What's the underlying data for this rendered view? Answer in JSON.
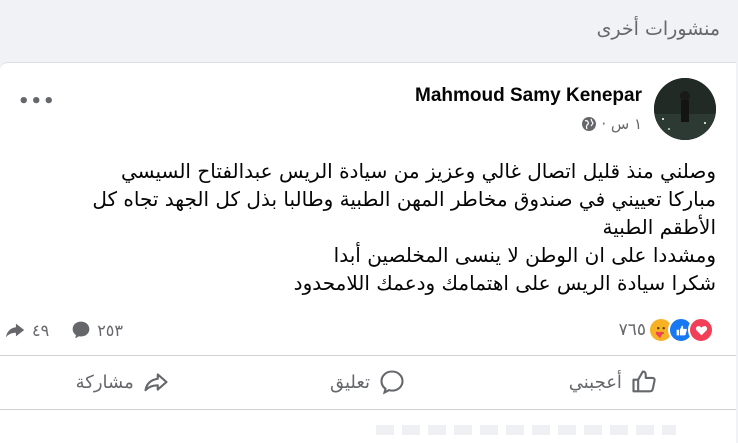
{
  "section": {
    "title": "منشورات أخرى"
  },
  "post": {
    "author": "Mahmoud Samy Kenepar",
    "time": "١ س ·",
    "privacy_icon": "globe-icon",
    "more_label": "•••",
    "text_lines": [
      "وصلني منذ قليل اتصال غالي وعزيز من سيادة الريس عبدالفتاح السيسي",
      "مباركا تعييني في صندوق مخاطر المهن الطبية وطالبا بذل كل الجهد تجاه كل",
      "الأطقم الطبية",
      "ومشددا على ان الوطن لا ينسى المخلصين أبدا",
      "شكرا سيادة الريس على اهتمامك ودعمك اللامحدود"
    ],
    "reactions": {
      "count": "٧٦٥",
      "types": [
        "like-icon",
        "love-icon",
        "care-icon"
      ],
      "colors": {
        "like": "#1877f2",
        "love": "#f33e58",
        "care": "#f7b125"
      }
    },
    "comments_count": "٢٥٣",
    "shares_count": "٤٩",
    "actions": {
      "like_label": "أعجبني",
      "comment_label": "تعليق",
      "share_label": "مشاركة"
    }
  }
}
